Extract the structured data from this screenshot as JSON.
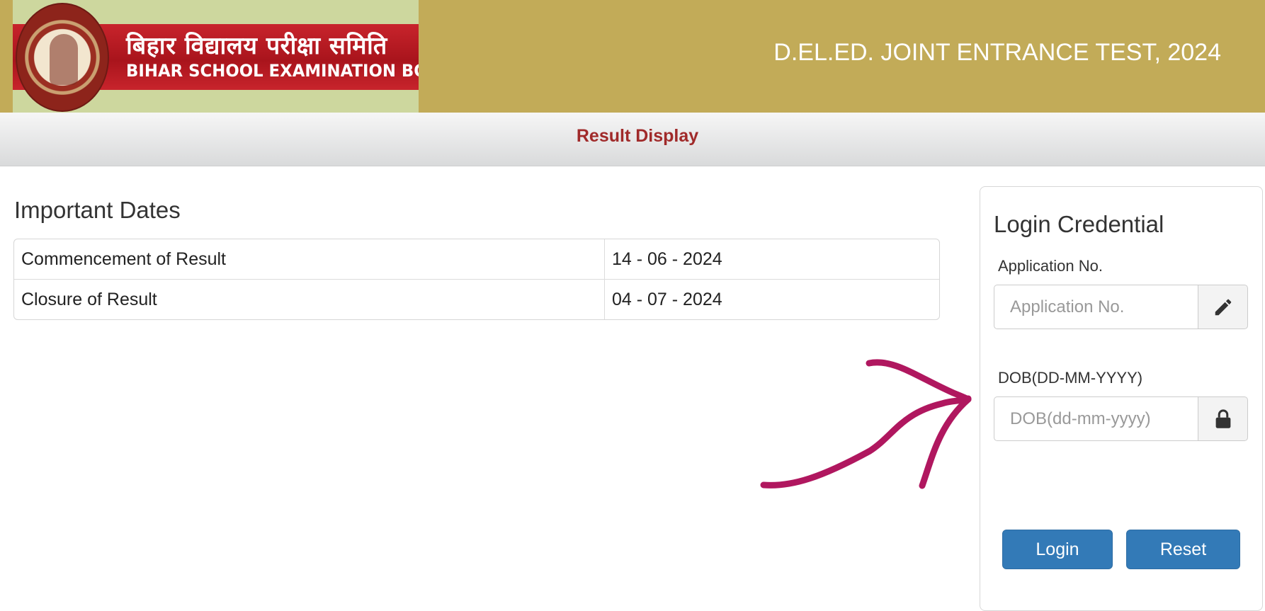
{
  "header": {
    "logo_hindi": "बिहार विद्यालय परीक्षा समिति",
    "logo_english": "BIHAR SCHOOL EXAMINATION BOARD",
    "exam_title": "D.EL.ED. JOINT ENTRANCE TEST, 2024"
  },
  "subheader": {
    "title": "Result Display"
  },
  "important_dates": {
    "heading": "Important Dates",
    "rows": [
      {
        "label": "Commencement of Result",
        "value": "14 - 06 - 2024"
      },
      {
        "label": "Closure of Result",
        "value": "04 - 07 - 2024"
      }
    ]
  },
  "login": {
    "heading": "Login Credential",
    "application_label": "Application No.",
    "application_placeholder": "Application No.",
    "application_value": "",
    "dob_label": "DOB(DD-MM-YYYY)",
    "dob_placeholder": "DOB(dd-mm-yyyy)",
    "dob_value": "",
    "login_button": "Login",
    "reset_button": "Reset"
  },
  "icons": {
    "application_addon": "pencil-icon",
    "dob_addon": "lock-icon",
    "annotation": "hand-drawn-arrow"
  },
  "colors": {
    "header_bg": "#c2ab58",
    "title_red": "#a02a2a",
    "button_blue": "#337ab7",
    "annotation_magenta": "#b0175f"
  }
}
